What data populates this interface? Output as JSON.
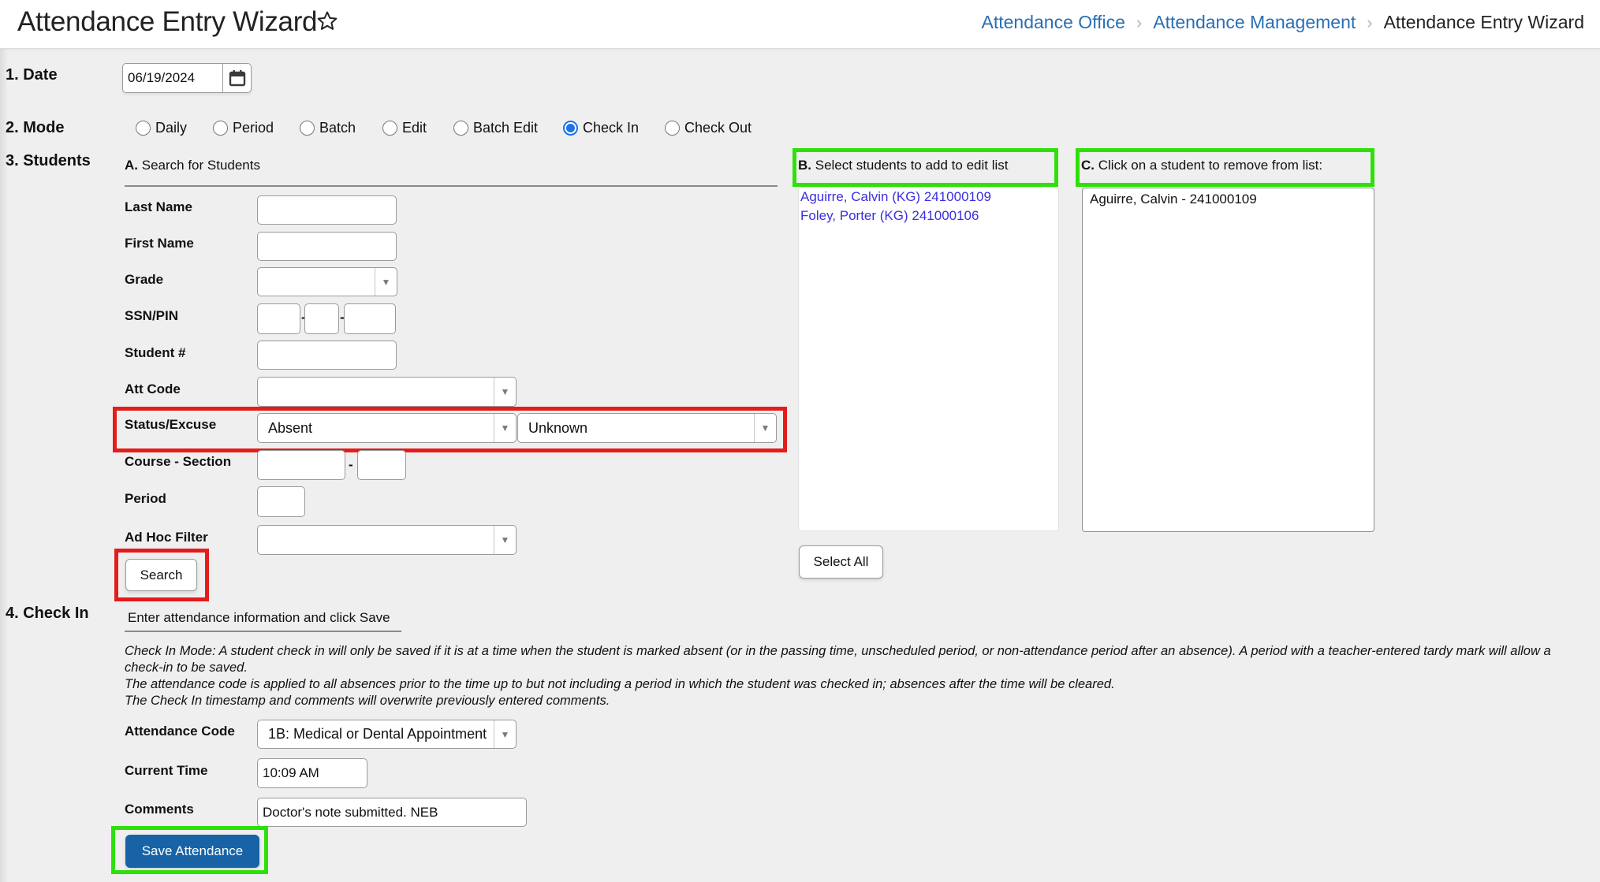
{
  "header": {
    "title": "Attendance Entry Wizard",
    "favorite_icon": "star-outline-icon",
    "breadcrumb": [
      {
        "label": "Attendance Office",
        "link": true
      },
      {
        "label": "Attendance Management",
        "link": true
      },
      {
        "label": "Attendance Entry Wizard",
        "link": false
      }
    ]
  },
  "sections": {
    "date": "1. Date",
    "mode": "2. Mode",
    "students": "3. Students",
    "check_in": "4. Check In"
  },
  "date": {
    "value": "06/19/2024",
    "icon": "calendar-icon"
  },
  "mode": {
    "options": [
      "Daily",
      "Period",
      "Batch",
      "Edit",
      "Batch Edit",
      "Check In",
      "Check Out"
    ],
    "selected": "Check In"
  },
  "search": {
    "heading_prefix": "A.",
    "heading": "Search for Students",
    "fields": {
      "last_name": {
        "label": "Last Name",
        "value": ""
      },
      "first_name": {
        "label": "First Name",
        "value": ""
      },
      "grade": {
        "label": "Grade",
        "value": ""
      },
      "ssn": {
        "label": "SSN/PIN",
        "part1": "",
        "part2": "",
        "part3": "",
        "separator": "-"
      },
      "student_num": {
        "label": "Student #",
        "value": ""
      },
      "att_code": {
        "label": "Att Code",
        "value": ""
      },
      "status_excuse": {
        "label": "Status/Excuse",
        "status": "Absent",
        "excuse": "Unknown"
      },
      "course_section": {
        "label": "Course - Section",
        "course": "",
        "section": "",
        "separator": "-"
      },
      "period": {
        "label": "Period",
        "value": ""
      },
      "ad_hoc": {
        "label": "Ad Hoc Filter",
        "value": ""
      }
    },
    "search_button": "Search"
  },
  "list_b": {
    "heading_prefix": "B.",
    "heading": "Select students to add to edit list",
    "items": [
      "Aguirre, Calvin (KG) 241000109",
      "Foley, Porter (KG) 241000106"
    ],
    "select_all_button": "Select All"
  },
  "list_c": {
    "heading_prefix": "C.",
    "heading": "Click on a student to remove from list:",
    "items": [
      "Aguirre, Calvin - 241000109"
    ]
  },
  "check_in": {
    "heading": "Enter attendance information and click Save",
    "notes": [
      "Check In Mode: A student check in will only be saved if it is at a time when the student is marked absent (or in the passing time, unscheduled period, or non-attendance period after an absence). A period with a teacher-entered tardy mark will allow a check-in to be saved.",
      "The attendance code is applied to all absences prior to the time up to but not including a period in which the student was checked in; absences after the time will be cleared.",
      "The Check In timestamp and comments will overwrite previously entered comments."
    ],
    "attendance_code": {
      "label": "Attendance Code",
      "value": "1B: Medical or Dental Appointment"
    },
    "current_time": {
      "label": "Current Time",
      "value": "10:09 AM"
    },
    "comments": {
      "label": "Comments",
      "value": "Doctor's note submitted. NEB"
    },
    "save_button": "Save Attendance"
  },
  "colors": {
    "link": "#2a6fb5",
    "student_link": "#3b2ee0",
    "primary_button": "#1763a6",
    "radio_selected": "#1a73e8",
    "highlight_red": "#e31c1c",
    "highlight_green": "#2ee00a"
  }
}
